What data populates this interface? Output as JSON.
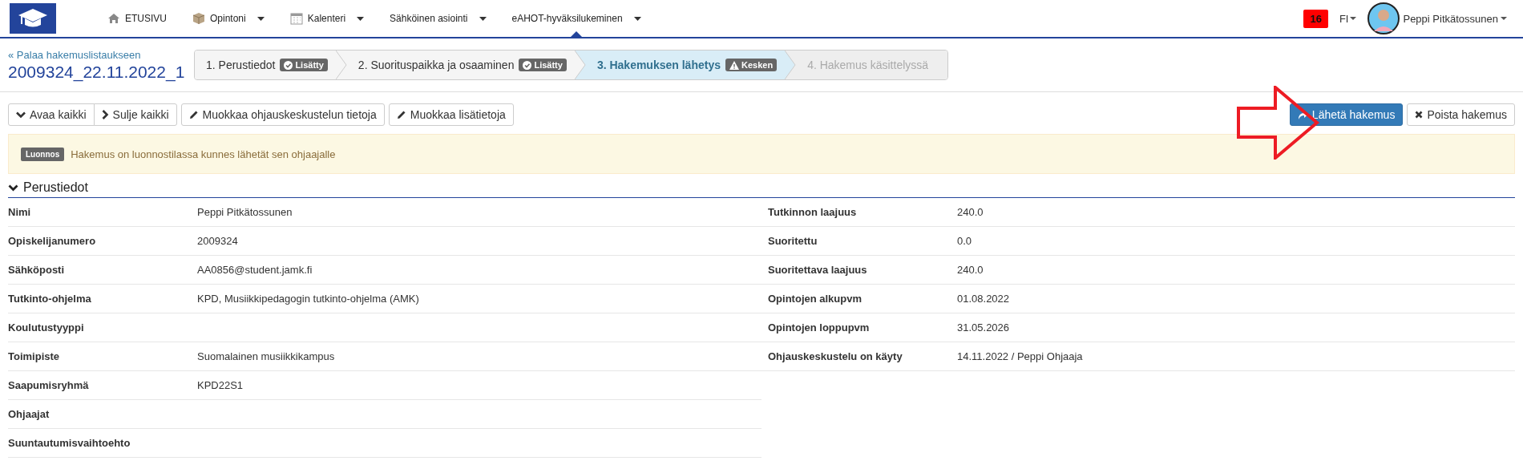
{
  "nav": {
    "items": [
      {
        "label": "ETUSIVU",
        "dropdown": false,
        "selected": false
      },
      {
        "label": "Opintoni",
        "dropdown": true,
        "selected": false
      },
      {
        "label": "Kalenteri",
        "dropdown": true,
        "selected": false
      },
      {
        "label": "Sähköinen asiointi",
        "dropdown": true,
        "selected": false
      },
      {
        "label": "eAHOT-hyväksilukeminen",
        "dropdown": true,
        "selected": true
      }
    ],
    "notification_count": "16",
    "language": "FI",
    "user": "Peppi Pitkätossunen"
  },
  "header": {
    "back_link": "« Palaa hakemuslistaukseen",
    "title": "2009324_22.11.2022_1"
  },
  "steps": [
    {
      "label": "1. Perustiedot",
      "selected": false,
      "disabled": false,
      "badge": "Lisätty"
    },
    {
      "label": "2. Suorituspaikka ja osaaminen",
      "selected": false,
      "disabled": false,
      "badge": "Lisätty"
    },
    {
      "label": "3. Hakemuksen lähetys",
      "selected": true,
      "disabled": false,
      "badge": "Kesken"
    },
    {
      "label": "4. Hakemus käsittelyssä",
      "selected": false,
      "disabled": true
    }
  ],
  "toolbar": {
    "left": [
      {
        "label": "Avaa kaikki"
      },
      {
        "label": "Sulje kaikki"
      },
      {
        "label": "Muokkaa ohjauskeskustelun tietoja"
      },
      {
        "label": "Muokkaa lisätietoja"
      }
    ],
    "right": [
      {
        "label": "Lähetä hakemus",
        "primary": true
      },
      {
        "label": "Poista hakemus",
        "primary": false
      }
    ]
  },
  "alert": {
    "badge": "Luonnos",
    "text": "Hakemus on luonnostilassa kunnes lähetät sen ohjaajalle"
  },
  "section": {
    "title": "Perustiedot",
    "expanded": true,
    "left": [
      {
        "label": "Nimi",
        "value": "Peppi Pitkätossunen"
      },
      {
        "label": "Opiskelijanumero",
        "value": "2009324"
      },
      {
        "label": "Sähköposti",
        "value": "AA0856@student.jamk.fi"
      },
      {
        "label": "Tutkinto-ohjelma",
        "value": "KPD, Musiikkipedagogin tutkinto-ohjelma (AMK)"
      },
      {
        "label": "Koulutustyyppi"
      },
      {
        "label": "Toimipiste",
        "value": "Suomalainen musiikkikampus"
      },
      {
        "label": "Saapumisryhmä",
        "value": "KPD22S1"
      },
      {
        "label": "Ohjaajat"
      },
      {
        "label": "Suuntautumisvaihtoehto"
      }
    ],
    "right": [
      {
        "label": "Tutkinnon laajuus",
        "value": "240.0"
      },
      {
        "label": "Suoritettu",
        "value": "0.0"
      },
      {
        "label": "Suoritettava laajuus",
        "value": "240.0"
      },
      {
        "label": "Opintojen alkupvm",
        "value": "01.08.2022"
      },
      {
        "label": "Opintojen loppupvm",
        "value": "31.05.2026"
      },
      {
        "label": "Ohjauskeskustelu on käyty",
        "value": "14.11.2022 / Peppi Ohjaaja"
      }
    ]
  }
}
